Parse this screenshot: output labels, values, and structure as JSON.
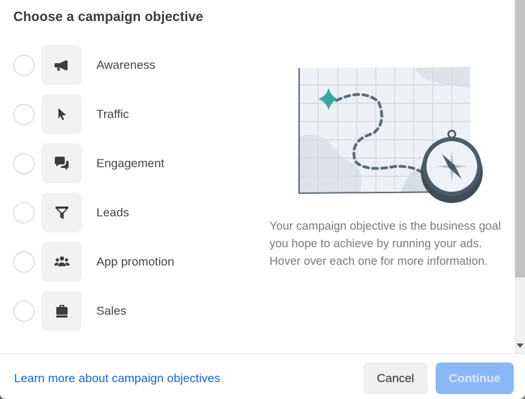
{
  "dialog": {
    "title": "Choose a campaign objective",
    "objectives": [
      {
        "label": "Awareness",
        "icon": "megaphone-icon",
        "selected": false
      },
      {
        "label": "Traffic",
        "icon": "cursor-icon",
        "selected": false
      },
      {
        "label": "Engagement",
        "icon": "chat-bubbles-icon",
        "selected": false
      },
      {
        "label": "Leads",
        "icon": "funnel-icon",
        "selected": false
      },
      {
        "label": "App promotion",
        "icon": "people-icon",
        "selected": false
      },
      {
        "label": "Sales",
        "icon": "shopping-bag-icon",
        "selected": false
      }
    ],
    "illustration": "map-compass-illustration",
    "description": "Your campaign objective is the business goal you hope to achieve by running your ads. Hover over each one for more information."
  },
  "footer": {
    "learn_more_link": "Learn more about campaign objectives",
    "cancel_label": "Cancel",
    "continue_label": "Continue",
    "continue_enabled": false
  },
  "colors": {
    "link": "#1a64c8",
    "continue_disabled_bg": "#8ab8f5",
    "accent_teal": "#3aa7a3",
    "icon_dark": "#3a3b3c"
  }
}
